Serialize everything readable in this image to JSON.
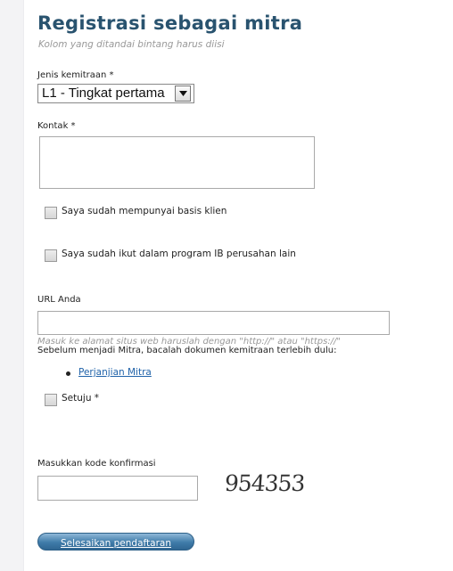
{
  "form": {
    "title": "Registrasi sebagai mitra",
    "subtitle": "Kolom yang ditandai bintang harus diisi",
    "partnership_type": {
      "label": "Jenis kemitraan *",
      "value": "L1 - Tingkat pertama"
    },
    "contact": {
      "label": "Kontak *",
      "value": ""
    },
    "checkbox_client_base": {
      "label": "Saya sudah mempunyai basis klien",
      "checked": false
    },
    "checkbox_ib_program": {
      "label": "Saya sudah ikut dalam program IB perusahan lain",
      "checked": false
    },
    "url": {
      "label": "URL Anda",
      "value": "",
      "hint": "Masuk ke alamat situs web haruslah dengan \"http://\" atau \"https://\""
    },
    "agreement_notice": "Sebelum menjadi Mitra, bacalah dokumen kemitraan terlebih dulu:",
    "agreement_link": "Perjanjian Mitra",
    "agree_checkbox": {
      "label": "Setuju *",
      "checked": false
    },
    "captcha": {
      "label": "Masukkan kode konfirmasi",
      "value": "",
      "code": "954353"
    },
    "submit_label": "Selesaikan pendaftaran"
  },
  "icons": {
    "select_arrow": "chevron-down-icon",
    "resize_grip": "resize-grip-icon"
  },
  "colors": {
    "title": "#29536f",
    "link": "#1f62a9",
    "button": "#3f7ba9"
  }
}
